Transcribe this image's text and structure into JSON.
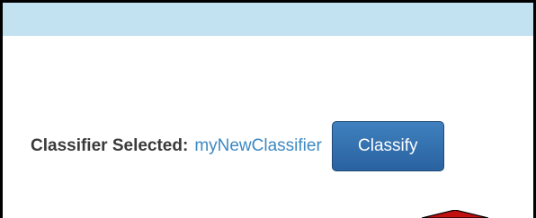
{
  "classifier": {
    "label": "Classifier Selected:",
    "selected_name": "myNewClassifier"
  },
  "actions": {
    "classify_label": "Classify"
  },
  "annotation": {
    "icon": "red-arrow-up-icon",
    "color": "#c01010"
  },
  "colors": {
    "header_bar": "#c2e2f2",
    "button": "#3f80be",
    "link": "#3d89c4"
  }
}
